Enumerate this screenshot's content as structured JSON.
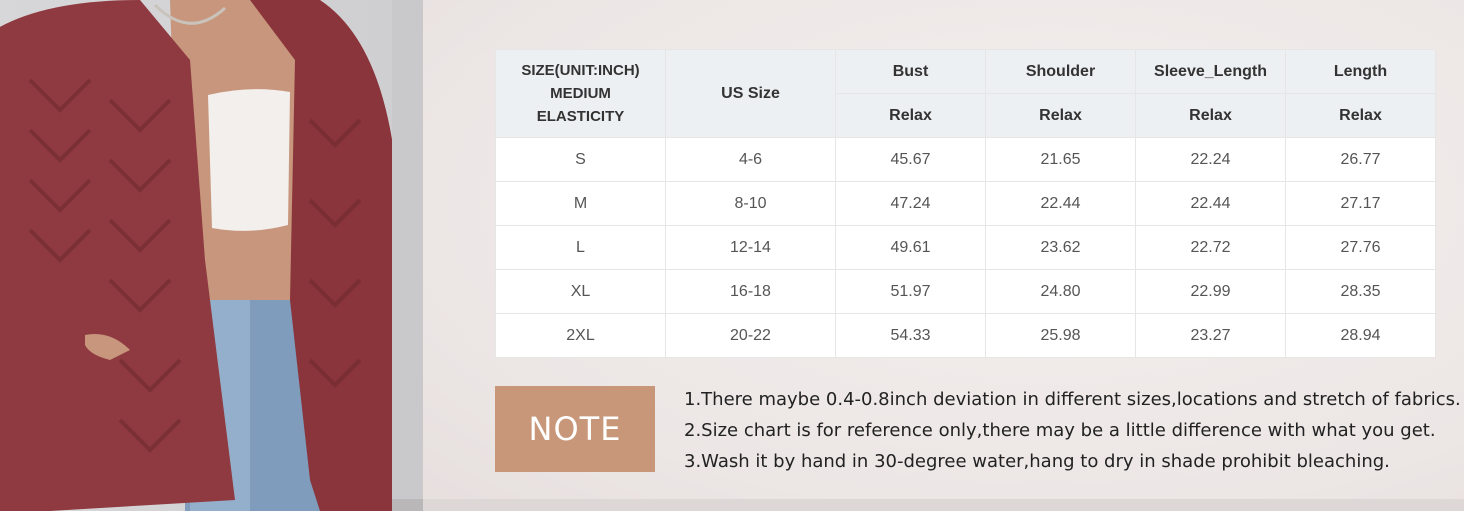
{
  "size_chart": {
    "header": {
      "first": [
        "SIZE(UNIT:INCH)",
        "MEDIUM",
        "ELASTICITY"
      ],
      "us_size": "US Size",
      "measurements": [
        "Bust",
        "Shoulder",
        "Sleeve_Length",
        "Length"
      ],
      "fit": [
        "Relax",
        "Relax",
        "Relax",
        "Relax"
      ]
    },
    "rows": [
      [
        "S",
        "4-6",
        "45.67",
        "21.65",
        "22.24",
        "26.77"
      ],
      [
        "M",
        "8-10",
        "47.24",
        "22.44",
        "22.44",
        "27.17"
      ],
      [
        "L",
        "12-14",
        "49.61",
        "23.62",
        "22.72",
        "27.76"
      ],
      [
        "XL",
        "16-18",
        "51.97",
        "24.80",
        "22.99",
        "28.35"
      ],
      [
        "2XL",
        "20-22",
        "54.33",
        "25.98",
        "23.27",
        "28.94"
      ]
    ]
  },
  "note": {
    "label": "NOTE",
    "lines": [
      "1.There maybe 0.4-0.8inch deviation in different sizes,locations and stretch of fabrics.",
      "2.Size chart is for reference only,there may be a little difference with what you get.",
      "3.Wash it by hand in 30-degree water,hang to dry in shade prohibit bleaching."
    ]
  },
  "colors": {
    "note_box": "#c8977a",
    "header_bg": "#edf0f2",
    "jacket": "#8f3a40"
  }
}
